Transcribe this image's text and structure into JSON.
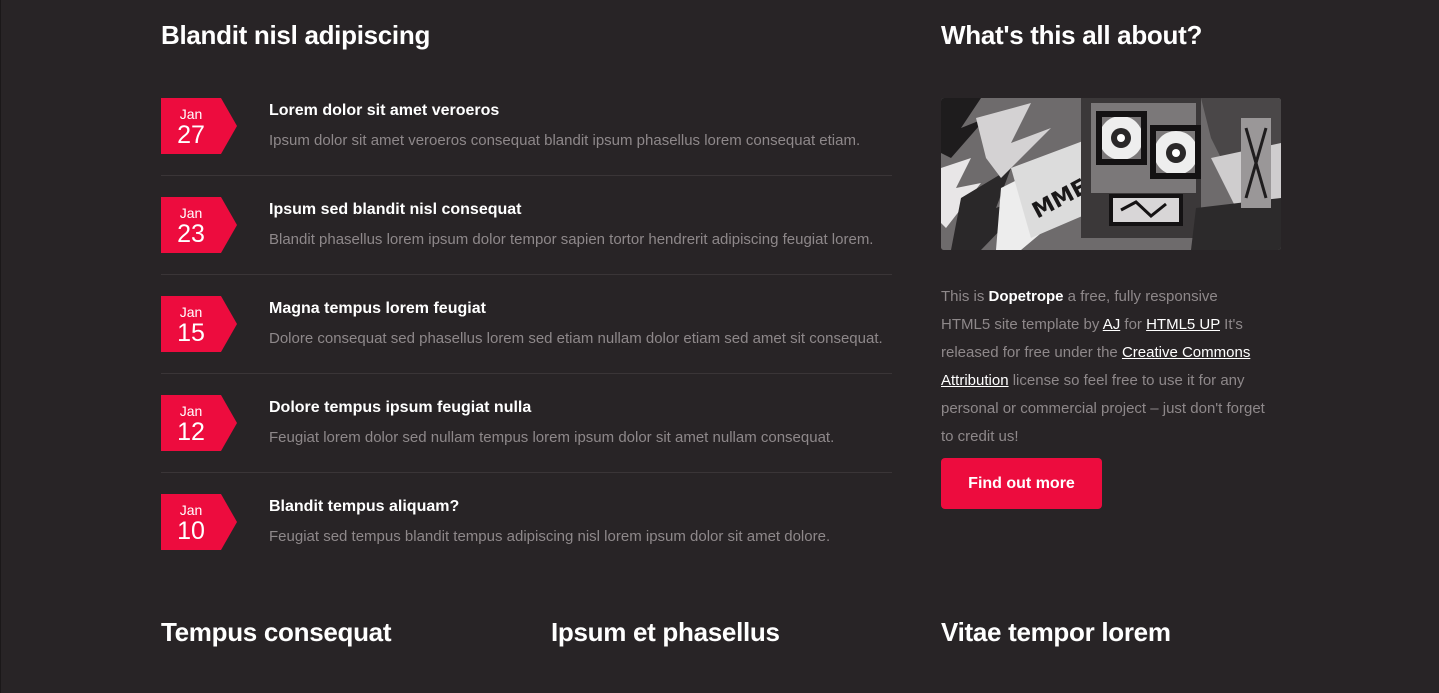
{
  "main": {
    "title": "Blandit nisl adipiscing",
    "posts": [
      {
        "month": "Jan",
        "day": "27",
        "title": "Lorem dolor sit amet veroeros",
        "text": "Ipsum dolor sit amet veroeros consequat blandit ipsum phasellus lorem consequat etiam."
      },
      {
        "month": "Jan",
        "day": "23",
        "title": "Ipsum sed blandit nisl consequat",
        "text": "Blandit phasellus lorem ipsum dolor tempor sapien tortor hendrerit adipiscing feugiat lorem."
      },
      {
        "month": "Jan",
        "day": "15",
        "title": "Magna tempus lorem feugiat",
        "text": "Dolore consequat sed phasellus lorem sed etiam nullam dolor etiam sed amet sit consequat."
      },
      {
        "month": "Jan",
        "day": "12",
        "title": "Dolore tempus ipsum feugiat nulla",
        "text": "Feugiat lorem dolor sed nullam tempus lorem ipsum dolor sit amet nullam consequat."
      },
      {
        "month": "Jan",
        "day": "10",
        "title": "Blandit tempus aliquam?",
        "text": "Feugiat sed tempus blandit tempus adipiscing nisl lorem ipsum dolor sit amet dolore."
      }
    ]
  },
  "sidebar": {
    "title": "What's this all about?",
    "text_1": "This is ",
    "brand": "Dopetrope",
    "text_2": " a free, fully responsive HTML5 site template by ",
    "author_link": "AJ",
    "text_3": " for ",
    "site_link": "HTML5 UP",
    "text_4": " It's released for free under the ",
    "license_link": "Creative Commons Attribution",
    "text_5": " license so feel free to use it for any personal or commercial project – just don't forget to credit us!",
    "button_label": "Find out more"
  },
  "bottom": {
    "col1_title": "Tempus consequat",
    "col2_title": "Ipsum et phasellus",
    "col3_title": "Vitae tempor lorem"
  },
  "colors": {
    "background": "#282426",
    "accent": "#ed0c3e",
    "muted_text": "#8e888a"
  }
}
